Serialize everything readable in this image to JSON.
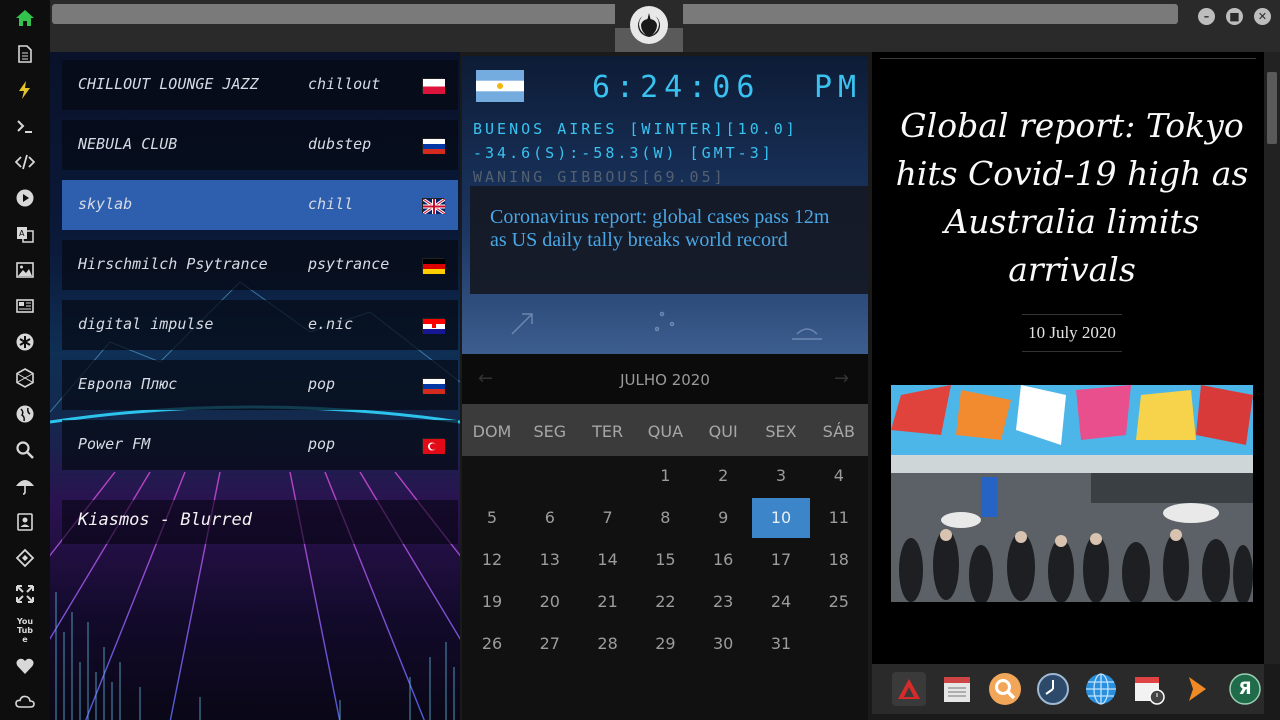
{
  "sidebar": {
    "icons": [
      "home-icon",
      "document-icon",
      "lightning-icon",
      "terminal-icon",
      "code-icon",
      "play-icon",
      "translate-icon",
      "image-icon",
      "newspaper-icon",
      "star-of-life-icon",
      "hexagon-icon",
      "globe-icon",
      "search-icon",
      "umbrella-icon",
      "contacts-icon",
      "extension-icon",
      "fullscreen-icon",
      "youtube-icon",
      "heart-icon",
      "cloud-icon"
    ],
    "youtube_label": "You Tube"
  },
  "window_buttons": {
    "minimize": "–",
    "maximize": "■",
    "close": "✕"
  },
  "radio": {
    "stations": [
      {
        "name": "CHILLOUT LOUNGE JAZZ",
        "genre": "chillout",
        "flag": "poland"
      },
      {
        "name": "NEBULA CLUB",
        "genre": "dubstep",
        "flag": "russia"
      },
      {
        "name": "skylab",
        "genre": "chill",
        "flag": "uk"
      },
      {
        "name": "Hirschmilch Psytrance",
        "genre": "psytrance",
        "flag": "germany"
      },
      {
        "name": "digital impulse",
        "genre": "e.nic",
        "flag": "croatia"
      },
      {
        "name": "Европа Плюс",
        "genre": "pop",
        "flag": "russia"
      },
      {
        "name": "Power FM",
        "genre": "pop",
        "flag": "turkey"
      }
    ],
    "active_index": 2,
    "now_playing": "Kiasmos - Blurred"
  },
  "clock": {
    "time": "6:24:06",
    "ampm": "PM",
    "location": "BUENOS AIRES [WINTER][10.0]",
    "coords": "-34.6(S):-58.3(W) [GMT-3]",
    "moon": "WANING GIBBOUS[69.05]",
    "headline": "Coronavirus report: global cases pass 12m as US daily tally breaks world record"
  },
  "calendar": {
    "title": "JULHO 2020",
    "prev": "←",
    "next": "→",
    "weekdays": [
      "DOM",
      "SEG",
      "TER",
      "QUA",
      "QUI",
      "SEX",
      "SÁB"
    ],
    "rows": [
      [
        "",
        "",
        "",
        "1",
        "2",
        "3",
        "4"
      ],
      [
        "5",
        "6",
        "7",
        "8",
        "9",
        "10",
        "11"
      ],
      [
        "12",
        "13",
        "14",
        "15",
        "16",
        "17",
        "18"
      ],
      [
        "19",
        "20",
        "21",
        "22",
        "23",
        "24",
        "25"
      ],
      [
        "26",
        "27",
        "28",
        "29",
        "30",
        "31",
        ""
      ]
    ],
    "selected": "10"
  },
  "article": {
    "title": "Global report: Tokyo hits Covid-19 high as Australia limits arrivals",
    "date": "10 July 2020"
  },
  "dock": {
    "icons": [
      "red-triangle-app-icon",
      "calendar-notes-icon",
      "magnifier-icon",
      "clock-icon",
      "globe-icon",
      "calendar-clock-icon",
      "orange-arrow-icon",
      "yandex-icon"
    ],
    "yandex_letter": "Я"
  },
  "colors": {
    "accent": "#39c2f0",
    "selected_day": "#3c85c9",
    "active_station": "#2d5fae",
    "headline": "#4aa7e6"
  }
}
